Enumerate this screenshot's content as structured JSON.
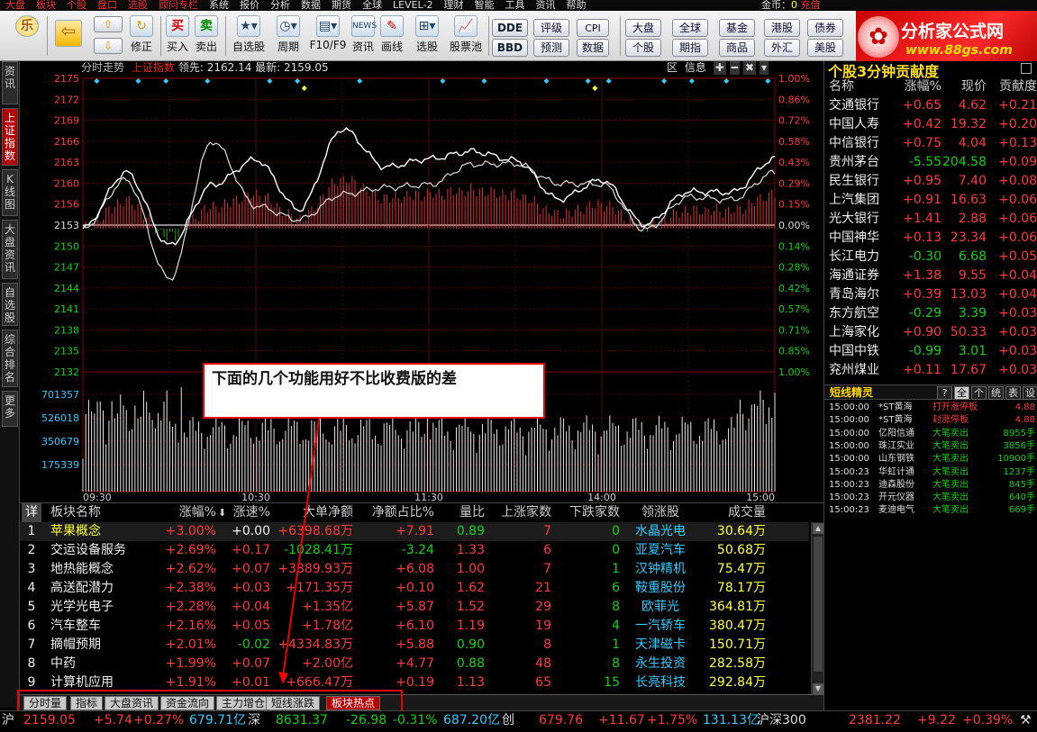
{
  "menu": {
    "items": [
      "大盘",
      "板块",
      "个股",
      "盘口",
      "选股",
      "顾问专栏",
      "系统",
      "报价",
      "分析",
      "数据",
      "期货",
      "全球",
      "LEVEL-2",
      "理财",
      "智能",
      "工具",
      "资讯",
      "帮助"
    ]
  },
  "account": {
    "coin_label": "金币：",
    "coin_value": "0",
    "recharge": "充值"
  },
  "logo": {
    "title": "分析家公式网",
    "url_text": "www.88gs.com"
  },
  "toolbar": {
    "buy": "买入",
    "sell": "卖出",
    "fix": "修正",
    "watchlist": "自选股",
    "period": "周期",
    "f10": "F10/F9",
    "news": "资讯",
    "draw": "画线",
    "select": "选股",
    "pool": "股票池",
    "dde": "DDE",
    "bbd": "BBD",
    "rating": "评级",
    "forecast": "预测",
    "cpi": "CPI",
    "data": "数据",
    "market": "大盘",
    "stock": "个股",
    "global": "全球",
    "futures": "期指",
    "fund": "基金",
    "commodity": "商品",
    "hk": "港股",
    "fx": "外汇",
    "bond": "债券",
    "us": "美股"
  },
  "left_tabs": [
    "资讯",
    "上证指数",
    "K线图",
    "大盘资讯",
    "自选股",
    "综合排名",
    "更多"
  ],
  "chart": {
    "title": "分时走势",
    "index_name": "上证指数",
    "lead_label": "领先: ",
    "lead_value": "2162.14",
    "latest_label": "最新: ",
    "latest_value": "2159.05",
    "tools": [
      "区",
      "信息"
    ],
    "price_ticks": [
      "2175",
      "2172",
      "2169",
      "2166",
      "2163",
      "2160",
      "2156",
      "2153",
      "2150",
      "2147",
      "2144",
      "2141",
      "2138",
      "2135",
      "2132"
    ],
    "pct_ticks": [
      "1.00%",
      "0.86%",
      "0.72%",
      "0.58%",
      "0.43%",
      "0.29%",
      "0.15%",
      "0.00%",
      "0.14%",
      "0.28%",
      "0.42%",
      "0.57%",
      "0.71%",
      "0.85%",
      "1.00%"
    ],
    "vol_ticks": [
      "701357",
      "526018",
      "350679",
      "175339"
    ],
    "time_ticks": [
      "09:30",
      "10:30",
      "11:30",
      "14:00",
      "15:00"
    ]
  },
  "chart_data": {
    "type": "line",
    "title": "上证指数 分时走势",
    "x": [
      "09:30",
      "09:45",
      "10:00",
      "10:15",
      "10:30",
      "10:45",
      "11:00",
      "11:15",
      "11:30",
      "13:15",
      "13:30",
      "13:45",
      "14:00",
      "14:15",
      "14:30",
      "14:45",
      "15:00"
    ],
    "series": [
      {
        "name": "最新",
        "values": [
          2153.0,
          2161.2,
          2150.5,
          2159.4,
          2163.1,
          2155.8,
          2167.6,
          2162.0,
          2163.2,
          2164.3,
          2163.0,
          2157.3,
          2160.1,
          2153.6,
          2158.4,
          2158.3,
          2163.2
        ]
      },
      {
        "name": "领先",
        "values": [
          2153.0,
          2160.1,
          2145.6,
          2165.8,
          2156.3,
          2154.3,
          2158.0,
          2159.0,
          2159.4,
          2162.4,
          2162.5,
          2159.6,
          2159.5,
          2152.8,
          2157.6,
          2157.2,
          2161.2
        ]
      }
    ],
    "ylim": [
      2132,
      2175
    ],
    "base": 2153,
    "volume_ylim": [
      0,
      876696
    ]
  },
  "table": {
    "headers": [
      "详",
      "板块名称",
      "涨幅%",
      "涨速%",
      "大单净额",
      "净额占比%",
      "量比",
      "上涨家数",
      "下跌家数",
      "领涨股",
      "成交量"
    ],
    "sort_arrow": "⬇",
    "rows": [
      {
        "n": "1",
        "name": "苹果概念",
        "pct": "+3.00%",
        "speed": "+0.00",
        "net": "+6398.68万",
        "ratio": "+7.91",
        "vr": "0.89",
        "up": "7",
        "down": "0",
        "lead": "水晶光电",
        "vol": "30.64万"
      },
      {
        "n": "2",
        "name": "交运设备服务",
        "pct": "+2.69%",
        "speed": "+0.17",
        "net": "-1028.41万",
        "ratio": "-3.24",
        "vr": "1.33",
        "up": "6",
        "down": "0",
        "lead": "亚夏汽车",
        "vol": "50.68万"
      },
      {
        "n": "3",
        "name": "地热能概念",
        "pct": "+2.62%",
        "speed": "+0.07",
        "net": "+3889.93万",
        "ratio": "+6.08",
        "vr": "1.00",
        "up": "7",
        "down": "1",
        "lead": "汉钟精机",
        "vol": "75.47万"
      },
      {
        "n": "4",
        "name": "高送配潜力",
        "pct": "+2.38%",
        "speed": "+0.03",
        "net": "+171.35万",
        "ratio": "+0.10",
        "vr": "1.62",
        "up": "21",
        "down": "6",
        "lead": "鞍重股份",
        "vol": "78.17万"
      },
      {
        "n": "5",
        "name": "光学光电子",
        "pct": "+2.28%",
        "speed": "+0.04",
        "net": "+1.35亿",
        "ratio": "+5.87",
        "vr": "1.52",
        "up": "29",
        "down": "8",
        "lead": "欧菲光",
        "vol": "364.81万"
      },
      {
        "n": "6",
        "name": "汽车整车",
        "pct": "+2.16%",
        "speed": "+0.05",
        "net": "+1.78亿",
        "ratio": "+6.10",
        "vr": "1.19",
        "up": "19",
        "down": "4",
        "lead": "一汽轿车",
        "vol": "380.47万"
      },
      {
        "n": "7",
        "name": "摘帽预期",
        "pct": "+2.01%",
        "speed": "-0.02",
        "net": "+4334.83万",
        "ratio": "+5.88",
        "vr": "0.90",
        "up": "8",
        "down": "1",
        "lead": "天津磁卡",
        "vol": "150.71万"
      },
      {
        "n": "8",
        "name": "中药",
        "pct": "+1.99%",
        "speed": "+0.07",
        "net": "+2.00亿",
        "ratio": "+4.77",
        "vr": "0.88",
        "up": "48",
        "down": "8",
        "lead": "永生投资",
        "vol": "282.58万"
      },
      {
        "n": "9",
        "name": "计算机应用",
        "pct": "+1.91%",
        "speed": "+0.01",
        "net": "+666.47万",
        "ratio": "+0.19",
        "vr": "1.13",
        "up": "65",
        "down": "15",
        "lead": "长亮科技",
        "vol": "292.84万"
      }
    ]
  },
  "bottom_tabs": [
    "分时量",
    "指标",
    "大盘资讯",
    "资金流向",
    "主力增仓",
    "短线涨跌",
    "板块热点"
  ],
  "annotation": {
    "text": "下面的几个功能用好不比收费版的差"
  },
  "status": {
    "sh_label": "沪",
    "sh_value": "2159.05",
    "sh_change": "+5.74",
    "sh_pct": "+0.27%",
    "sh_amount": "679.71亿",
    "sz_label": "深",
    "sz_value": "8631.37",
    "sz_change": "-26.98",
    "sz_pct": "-0.31%",
    "sz_amount": "687.20亿",
    "cy_label": "创",
    "cy_value": "679.76",
    "cy_change": "+11.67",
    "cy_pct": "+1.75%",
    "cy_amount": "131.13亿",
    "hs_label": "沪深300",
    "hs_value": "2381.22",
    "hs_change": "+9.22",
    "hs_pct": "+0.39%"
  },
  "right_panel": {
    "title": "个股3分钟贡献度",
    "headers": [
      "名称",
      "涨幅%",
      "现价",
      "贡献度"
    ],
    "rows": [
      {
        "name": "交通银行",
        "pct": "+0.65",
        "price": "4.62",
        "contrib": "+0.21"
      },
      {
        "name": "中国人寿",
        "pct": "+0.42",
        "price": "19.32",
        "contrib": "+0.20"
      },
      {
        "name": "中信银行",
        "pct": "+0.75",
        "price": "4.04",
        "contrib": "+0.13"
      },
      {
        "name": "贵州茅台",
        "pct": "-5.55",
        "price": "204.58",
        "contrib": "+0.09"
      },
      {
        "name": "民生银行",
        "pct": "+0.95",
        "price": "7.40",
        "contrib": "+0.08"
      },
      {
        "name": "上汽集团",
        "pct": "+0.91",
        "price": "16.63",
        "contrib": "+0.06"
      },
      {
        "name": "光大银行",
        "pct": "+1.41",
        "price": "2.88",
        "contrib": "+0.06"
      },
      {
        "name": "中国神华",
        "pct": "+0.13",
        "price": "23.34",
        "contrib": "+0.06"
      },
      {
        "name": "长江电力",
        "pct": "-0.30",
        "price": "6.68",
        "contrib": "+0.05"
      },
      {
        "name": "海通证券",
        "pct": "+1.38",
        "price": "9.55",
        "contrib": "+0.04"
      },
      {
        "name": "青岛海尔",
        "pct": "+0.39",
        "price": "13.03",
        "contrib": "+0.04"
      },
      {
        "name": "东方航空",
        "pct": "-0.29",
        "price": "3.39",
        "contrib": "+0.03"
      },
      {
        "name": "上海家化",
        "pct": "+0.90",
        "price": "50.33",
        "contrib": "+0.03"
      },
      {
        "name": "中国中铁",
        "pct": "-0.99",
        "price": "3.01",
        "contrib": "+0.03"
      },
      {
        "name": "兖州煤业",
        "pct": "+0.11",
        "price": "17.67",
        "contrib": "+0.03"
      }
    ],
    "short_title": "短线精灵",
    "short_tabs": [
      "?",
      "全",
      "个",
      "统",
      "表",
      "设"
    ],
    "short_rows": [
      {
        "time": "15:00:00",
        "name": "*ST黄海",
        "event": "打开涨停板",
        "val": "4.88",
        "color": "#ff3a3a"
      },
      {
        "time": "15:00:00",
        "name": "*ST黄海",
        "event": "封涨停板",
        "val": "4.88",
        "color": "#ff3a3a"
      },
      {
        "time": "15:00:00",
        "name": "亿阳信通",
        "event": "大笔卖出",
        "val": "8955手",
        "color": "#14d014"
      },
      {
        "time": "15:00:00",
        "name": "珠江实业",
        "event": "大笔卖出",
        "val": "3856手",
        "color": "#14d014"
      },
      {
        "time": "15:00:00",
        "name": "山东钢铁",
        "event": "大笔卖出",
        "val": "10900手",
        "color": "#14d014"
      },
      {
        "time": "15:00:23",
        "name": "华虹计通",
        "event": "大笔卖出",
        "val": "1237手",
        "color": "#14d014"
      },
      {
        "time": "15:00:23",
        "name": "迪森股份",
        "event": "大笔卖出",
        "val": "845手",
        "color": "#14d014"
      },
      {
        "time": "15:00:23",
        "name": "开元仪器",
        "event": "大笔卖出",
        "val": "640手",
        "color": "#14d014"
      },
      {
        "time": "15:00:23",
        "name": "麦迪电气",
        "event": "大笔卖出",
        "val": "669手",
        "color": "#14d014"
      }
    ]
  }
}
